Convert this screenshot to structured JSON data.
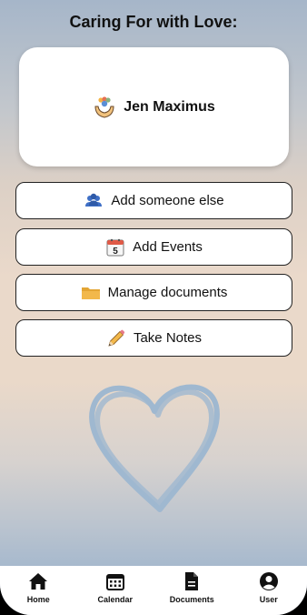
{
  "header": {
    "title": "Caring For with Love:"
  },
  "profile": {
    "name": "Jen Maximus",
    "icon": "caring-hands-icon"
  },
  "actions": [
    {
      "label": "Add someone else",
      "icon": "people-icon"
    },
    {
      "label": "Add Events",
      "icon": "calendar-icon",
      "icon_text": "5"
    },
    {
      "label": "Manage documents",
      "icon": "folder-icon"
    },
    {
      "label": "Take Notes",
      "icon": "pencil-icon"
    }
  ],
  "tabbar": {
    "items": [
      {
        "label": "Home",
        "icon": "home-icon"
      },
      {
        "label": "Calendar",
        "icon": "calendar-icon"
      },
      {
        "label": "Documents",
        "icon": "document-icon"
      },
      {
        "label": "User",
        "icon": "user-icon"
      }
    ]
  },
  "colors": {
    "accent_blue": "#3e6fc6",
    "folder": "#f2b84b",
    "heart_stroke": "#9fb8d0"
  }
}
